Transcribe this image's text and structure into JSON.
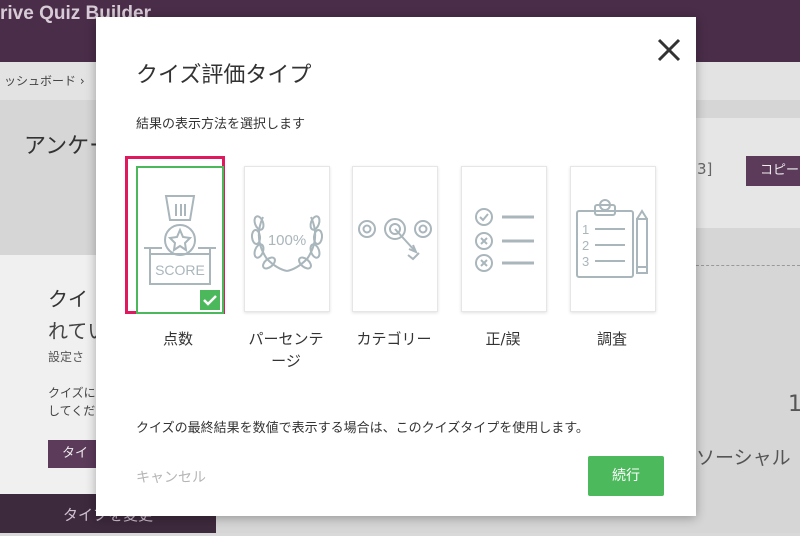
{
  "background": {
    "app_title": "rive Quiz Builder",
    "breadcrumb": "ッシュボード ›",
    "survey_title": "アンケー",
    "left_panel": {
      "heading_1": "クイ",
      "heading_2": "れてい",
      "text_1": "設定さ",
      "text_2": "クイズに",
      "text_3": "してくだ",
      "button": "タイ"
    },
    "bottom_button": "タイプを変更",
    "right_number": "3]",
    "copy_button": "コピー",
    "social_text": "ソーシャル",
    "side_number": "1"
  },
  "modal": {
    "title": "クイズ評価タイプ",
    "subtitle": "結果の表示方法を選択します",
    "options": [
      {
        "label": "点数",
        "icon": "medal-score-icon",
        "selected": true,
        "icon_text": "SCORE"
      },
      {
        "label": "パーセンテージ",
        "label_line1": "パーセンテ",
        "label_line2": "ージ",
        "icon": "laurel-percent-icon",
        "icon_text": "100%"
      },
      {
        "label": "カテゴリー",
        "icon": "target-arrow-icon"
      },
      {
        "label": "正/誤",
        "icon": "checklist-icon"
      },
      {
        "label": "調査",
        "icon": "clipboard-pencil-icon"
      }
    ],
    "description": "クイズの最終結果を数値で表示する場合は、このクイズタイプを使用します。",
    "cancel_label": "キャンセル",
    "continue_label": "続行",
    "colors": {
      "accent_green": "#4cb95d",
      "selection_outline": "#e0185e",
      "icon_gray": "#a9b6bc",
      "header_purple": "#4a2d49"
    }
  }
}
